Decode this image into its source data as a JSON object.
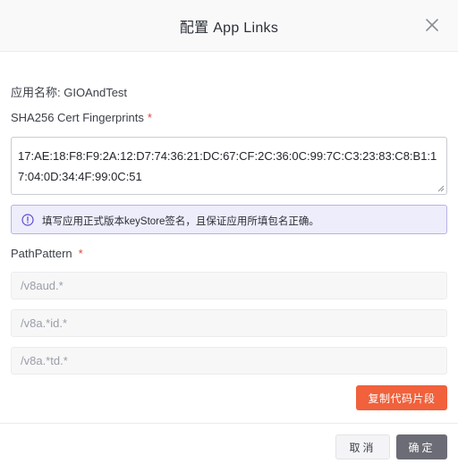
{
  "dialog": {
    "title": "配置 App Links",
    "close_icon": "close-icon"
  },
  "form": {
    "app_name": "应用名称: GIOAndTest",
    "fingerprint_label": "SHA256 Cert Fingerprints",
    "required_mark": "*",
    "fingerprint_value": "17:AE:18:F8:F9:2A:12:D7:74:36:21:DC:67:CF:2C:36:0C:99:7C:C3:23:83:C8:B1:17:04:0D:34:4F:99:0C:51",
    "info_icon": "info-circle-icon",
    "info_text": "填写应用正式版本keyStore签名，且保证应用所填包名正确。",
    "path_label": "PathPattern",
    "path_inputs": [
      {
        "placeholder": "/v8aud.*",
        "value": ""
      },
      {
        "placeholder": "/v8a.*id.*",
        "value": ""
      },
      {
        "placeholder": "/v8a.*td.*",
        "value": ""
      }
    ],
    "copy_button": "复制代码片段"
  },
  "footer": {
    "cancel": "取消",
    "ok": "确定"
  },
  "colors": {
    "accent": "#f0613c",
    "primary": "#6c6c76",
    "info_bg": "#eeedfb",
    "info_border": "#b8b2e6",
    "required": "#e0463c"
  }
}
